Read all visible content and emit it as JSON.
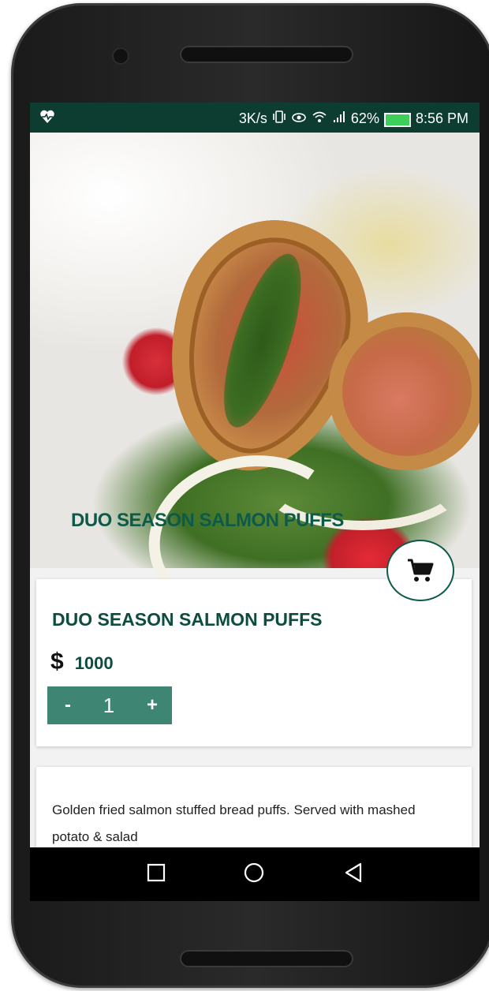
{
  "status_bar": {
    "network_speed": "3K/s",
    "battery_percent": "62%",
    "time": "8:56 PM",
    "icons": [
      "heart-monitor-icon",
      "vibrate-icon",
      "eye-icon",
      "wifi-icon",
      "signal-icon",
      "battery-charging-icon"
    ]
  },
  "hero": {
    "title": "DUO SEASON SALMON PUFFS",
    "image": "food-photo-salmon-puffs"
  },
  "cart": {
    "icon": "shopping-cart-icon"
  },
  "product": {
    "name": "DUO SEASON SALMON PUFFS",
    "currency_symbol": "$",
    "price": "1000",
    "quantity": {
      "decrement_label": "-",
      "value": "1",
      "increment_label": "+"
    }
  },
  "description": {
    "text": "Golden fried salmon stuffed bread puffs. Served with mashed potato & salad"
  },
  "nav": {
    "icons": [
      "recent-apps-icon",
      "home-icon",
      "back-icon"
    ]
  },
  "colors": {
    "brand_dark": "#0c3d30",
    "brand_text": "#0e4c3d",
    "stepper": "#3e8574"
  }
}
